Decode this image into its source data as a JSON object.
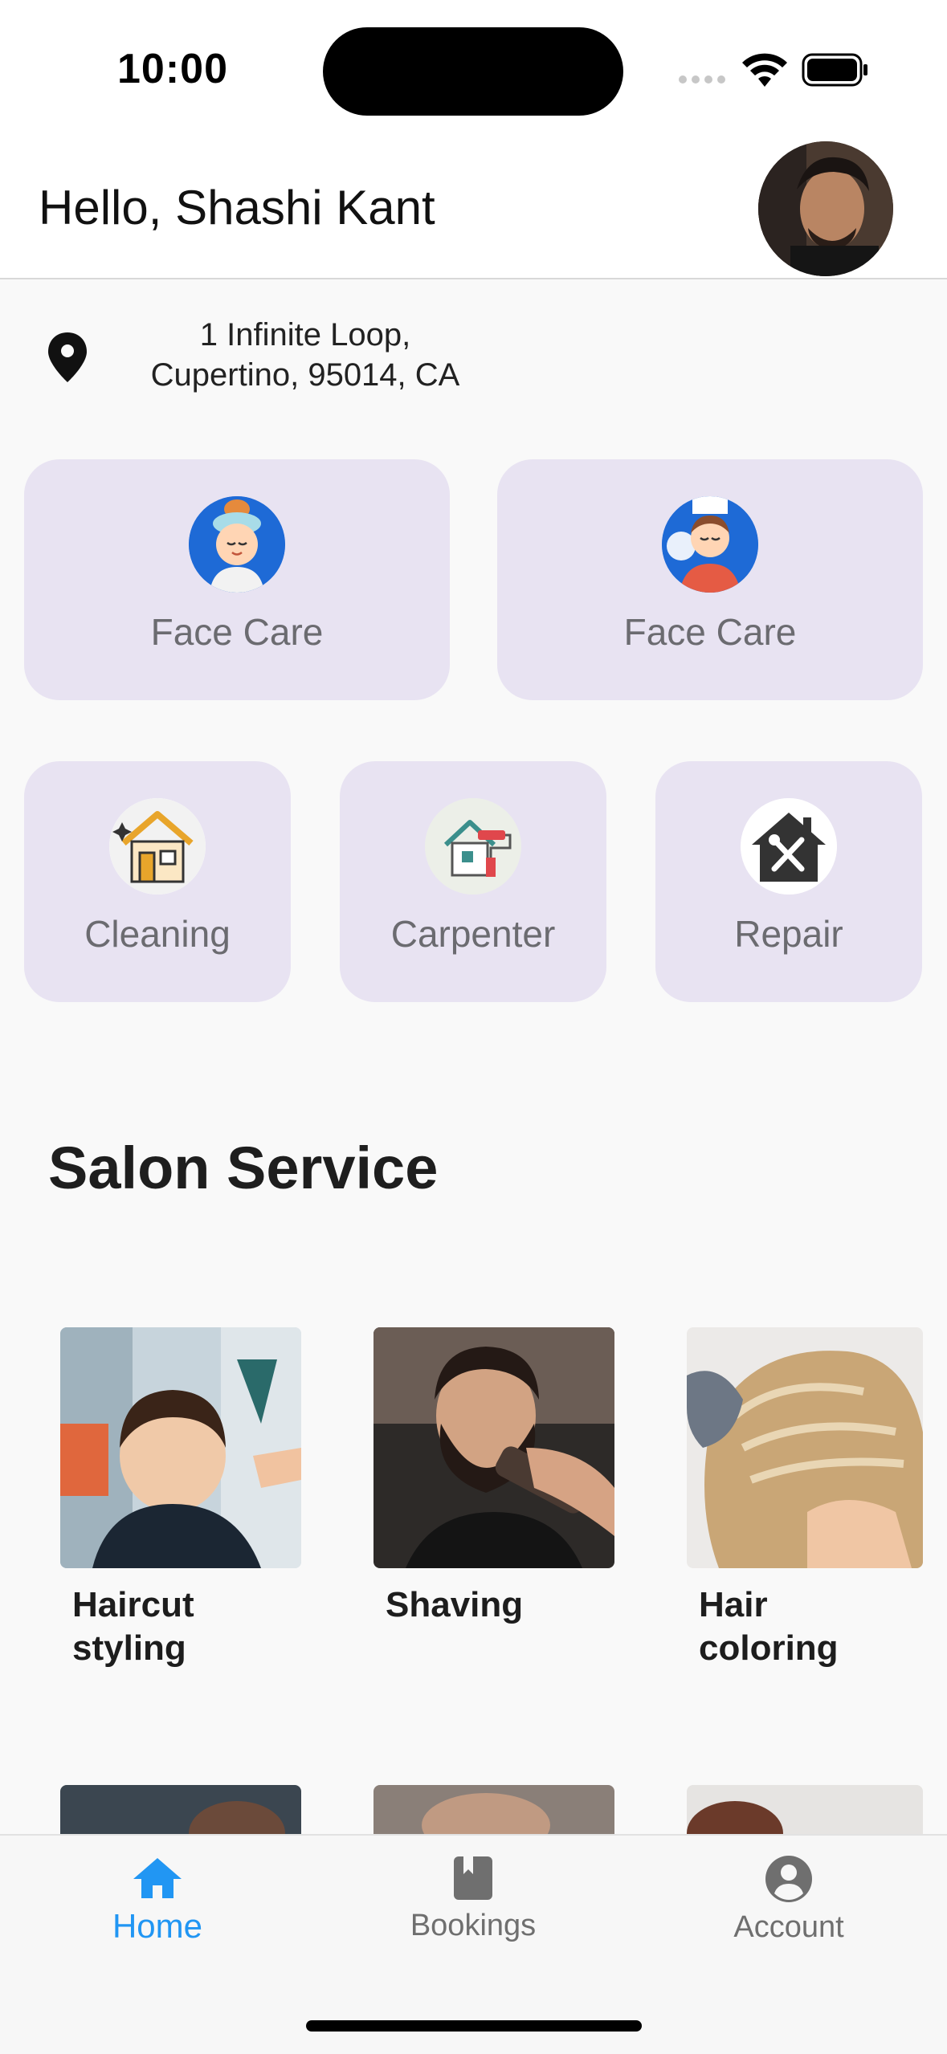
{
  "status_bar": {
    "time": "10:00"
  },
  "header": {
    "greeting": "Hello, Shashi Kant"
  },
  "location": {
    "line1": "1 Infinite Loop,",
    "line2": "Cupertino, 95014, CA"
  },
  "categories_row1": [
    {
      "label": "Face Care",
      "icon": "woman-face-care-icon"
    },
    {
      "label": "Face Care",
      "icon": "man-face-massage-icon"
    }
  ],
  "categories_row2": [
    {
      "label": "Cleaning",
      "icon": "house-cleaning-icon"
    },
    {
      "label": "Carpenter",
      "icon": "house-paint-roller-icon"
    },
    {
      "label": "Repair",
      "icon": "house-tools-icon"
    }
  ],
  "salon_section": {
    "title": "Salon Service",
    "items": [
      {
        "line1": "Haircut",
        "line2": "styling"
      },
      {
        "line1": "Shaving",
        "line2": ""
      },
      {
        "line1": "Hair",
        "line2": "coloring"
      }
    ]
  },
  "bottom_nav": {
    "items": [
      {
        "label": "Home",
        "icon": "home-icon",
        "active": true
      },
      {
        "label": "Bookings",
        "icon": "book-icon",
        "active": false
      },
      {
        "label": "Account",
        "icon": "account-circle-icon",
        "active": false
      }
    ]
  },
  "colors": {
    "accent": "#2196f3",
    "tile_bg": "#e8e3f2",
    "nav_inactive": "#6f6f6f"
  }
}
